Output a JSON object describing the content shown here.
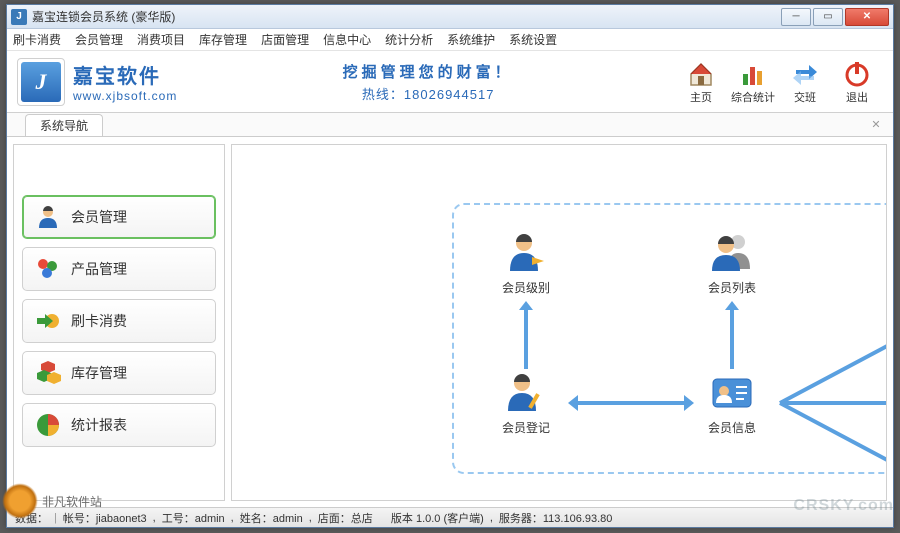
{
  "window": {
    "title": "嘉宝连锁会员系统 (豪华版)"
  },
  "menu": [
    "刷卡消费",
    "会员管理",
    "消费项目",
    "库存管理",
    "店面管理",
    "信息中心",
    "统计分析",
    "系统维护",
    "系统设置"
  ],
  "brand": {
    "logo_letter": "J",
    "name": "嘉宝软件",
    "url": "www.xjbsoft.com"
  },
  "header": {
    "slogan": "挖掘管理您的财富！",
    "hotline_label": "热线：",
    "hotline": "18026944517"
  },
  "toolbar": [
    {
      "key": "home",
      "label": "主页"
    },
    {
      "key": "stats",
      "label": "综合统计"
    },
    {
      "key": "shift",
      "label": "交班"
    },
    {
      "key": "exit",
      "label": "退出"
    }
  ],
  "tab": {
    "label": "系统导航"
  },
  "nav": [
    {
      "key": "member",
      "label": "会员管理",
      "active": true
    },
    {
      "key": "product",
      "label": "产品管理",
      "active": false
    },
    {
      "key": "card",
      "label": "刷卡消费",
      "active": false
    },
    {
      "key": "stock",
      "label": "库存管理",
      "active": false
    },
    {
      "key": "report",
      "label": "统计报表",
      "active": false
    }
  ],
  "diagram": {
    "nodes": {
      "level": "会员级别",
      "list": "会员列表",
      "register": "会员登记",
      "info": "会员信息"
    }
  },
  "status": {
    "data_label": "数据：",
    "account_label": "帐号：",
    "account": "jiabaonet3",
    "jobno_label": "工号：",
    "jobno": "admin",
    "name_label": "姓名：",
    "name": "admin",
    "store_label": "店面：",
    "store": "总店",
    "version_label": "版本",
    "version": "1.0.0 (客户端)",
    "server_label": "服务器：",
    "server": "113.106.93.80"
  },
  "watermark": {
    "text": "非凡软件站",
    "text2": "CRSKY.com"
  },
  "colors": {
    "accent": "#2a6ab8",
    "arrow": "#5aa0e0",
    "nav_active": "#6ac060"
  }
}
